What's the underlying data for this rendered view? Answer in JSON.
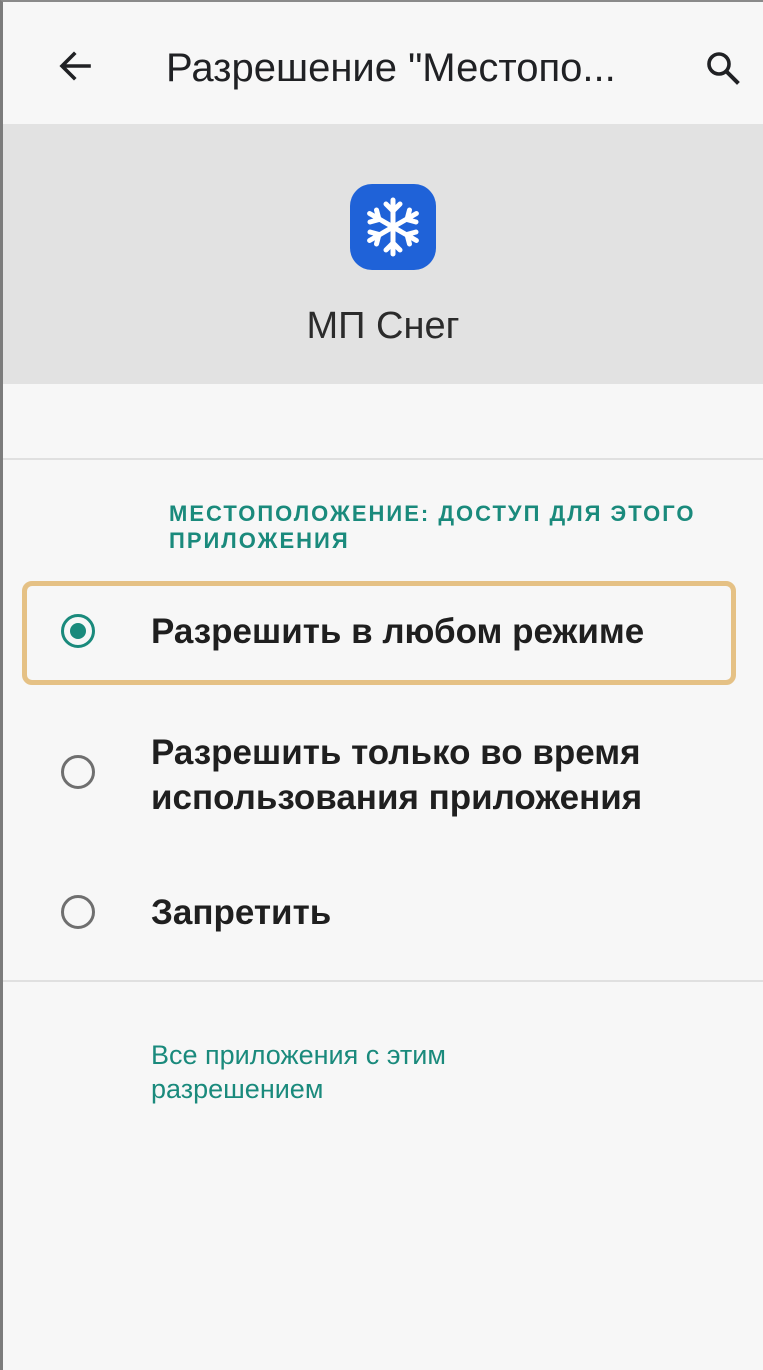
{
  "appbar": {
    "title": "Разрешение \"Местопо...",
    "back_icon": "arrow-back-icon",
    "search_icon": "search-icon"
  },
  "app": {
    "name": "МП Снег",
    "icon": "snowflake-icon",
    "icon_color": "#1f62d8"
  },
  "section": {
    "header": "МЕСТОПОЛОЖЕНИЕ: ДОСТУП ДЛЯ ЭТОГО ПРИЛОЖЕНИЯ"
  },
  "options": [
    {
      "label": "Разрешить в любом режиме",
      "selected": true
    },
    {
      "label": "Разрешить только во время использования приложения",
      "selected": false
    },
    {
      "label": "Запретить",
      "selected": false
    }
  ],
  "link": {
    "label": "Все приложения с этим разрешением"
  },
  "colors": {
    "accent": "#1a8a7c",
    "highlight": "#e5c185"
  }
}
